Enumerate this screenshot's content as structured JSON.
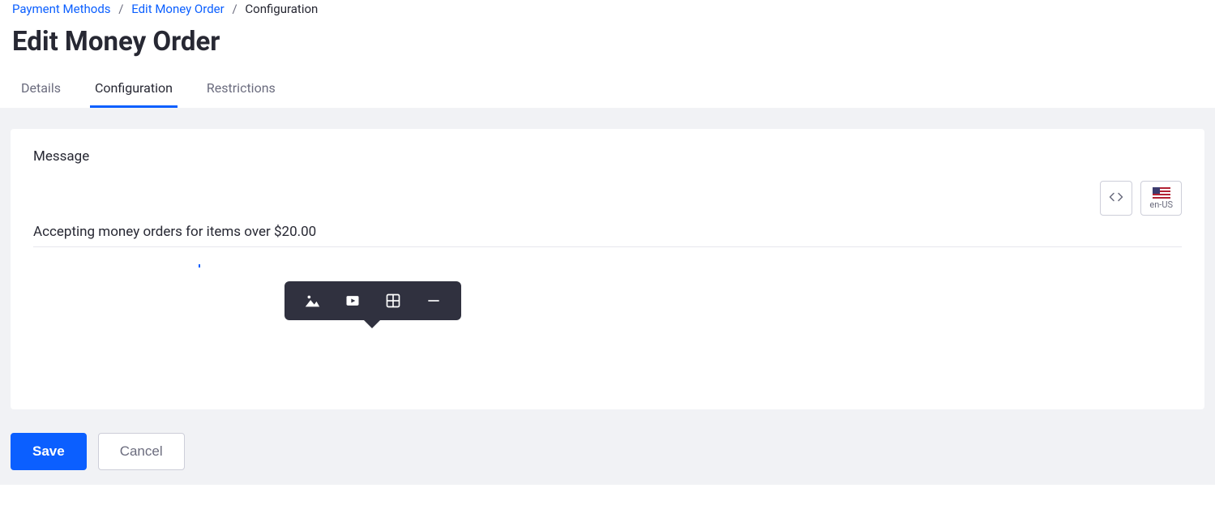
{
  "breadcrumb": {
    "items": [
      {
        "label": "Payment Methods",
        "link": true
      },
      {
        "label": "Edit Money Order",
        "link": true
      },
      {
        "label": "Configuration",
        "link": false
      }
    ]
  },
  "page": {
    "title": "Edit Money Order"
  },
  "tabs": [
    {
      "label": "Details",
      "active": false
    },
    {
      "label": "Configuration",
      "active": true
    },
    {
      "label": "Restrictions",
      "active": false
    }
  ],
  "editor": {
    "field_label": "Message",
    "content": "Accepting money orders for items over $20.00",
    "locale_code": "en-US",
    "popover": {
      "image_icon": "image-icon",
      "video_icon": "video-icon",
      "table_icon": "table-icon",
      "hr_icon": "horizontal-rule-icon"
    }
  },
  "actions": {
    "save": "Save",
    "cancel": "Cancel"
  }
}
